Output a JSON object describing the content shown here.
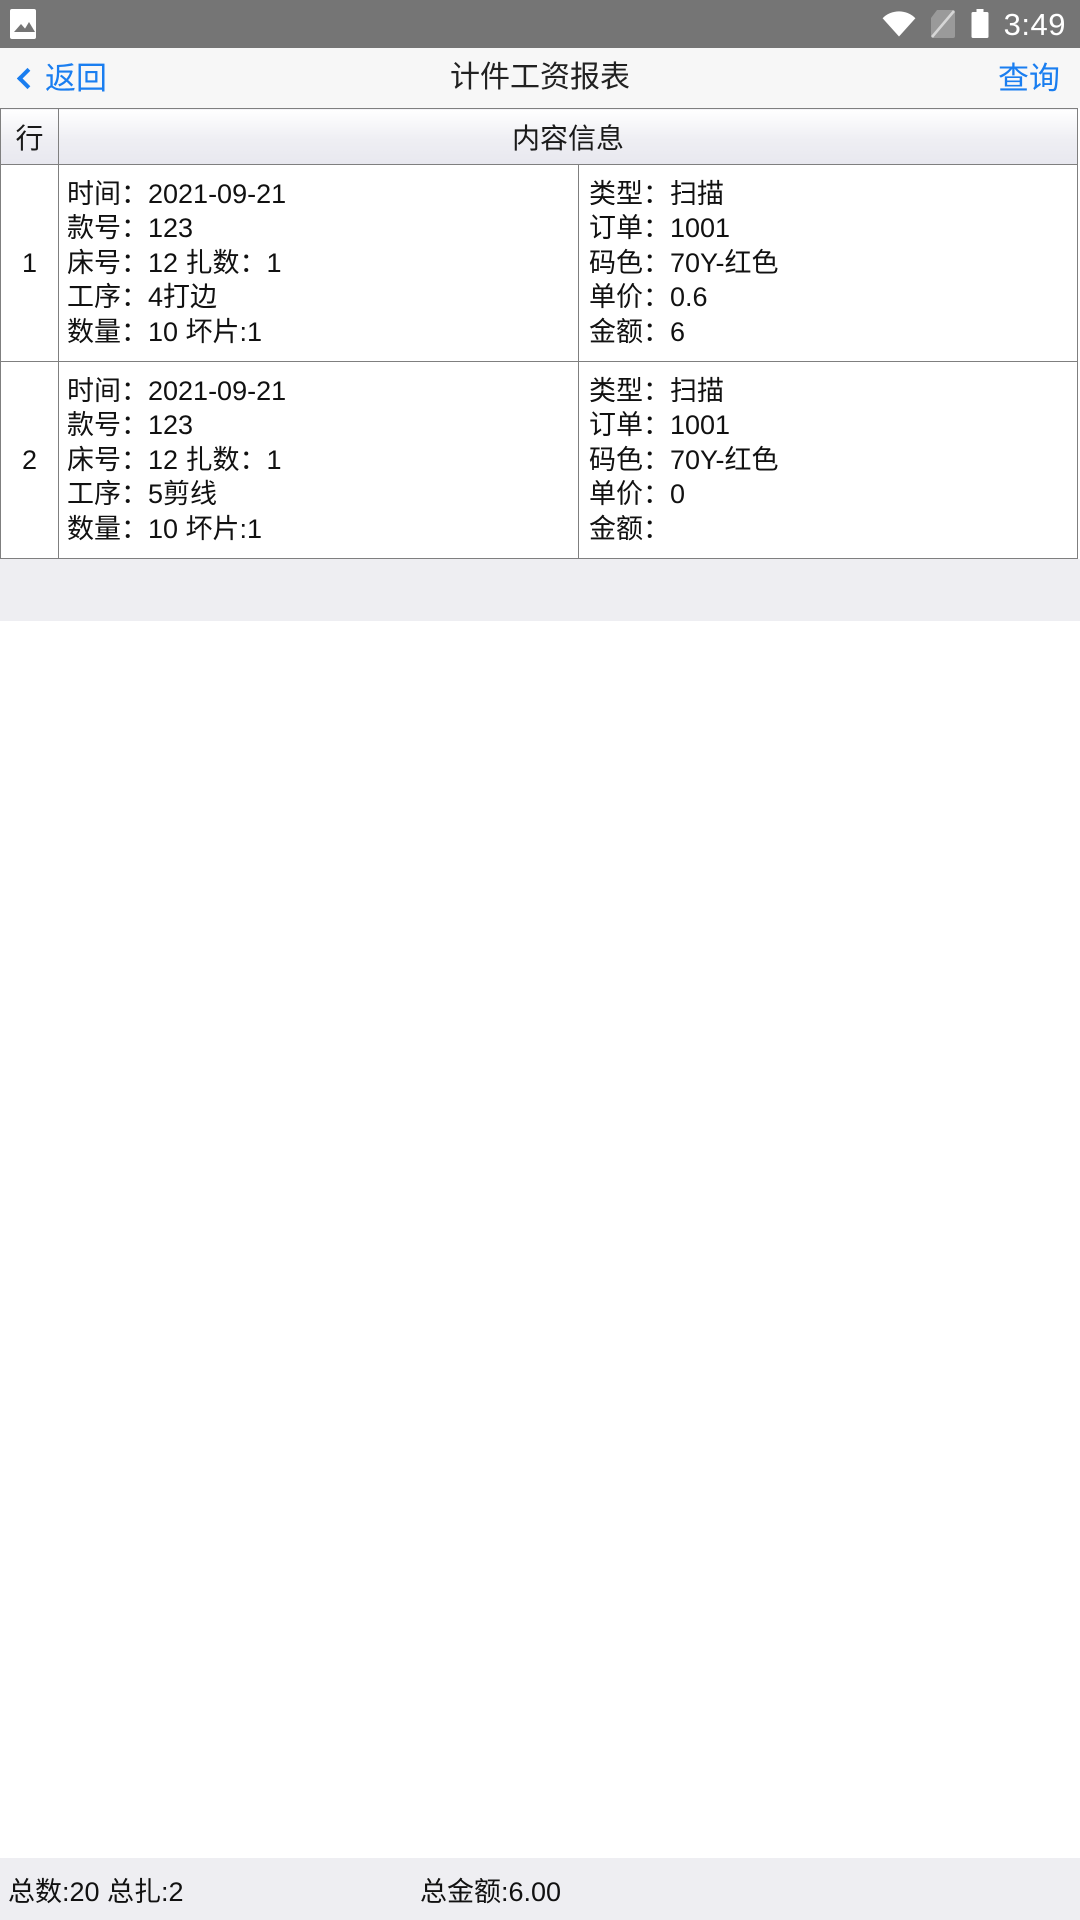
{
  "status_bar": {
    "time": "3:49",
    "icons": [
      "gallery-icon",
      "wifi-icon",
      "sim-card-off-icon",
      "battery-icon"
    ],
    "background_color": "#757575"
  },
  "header": {
    "back_label": "返回",
    "title": "计件工资报表",
    "action_label": "查询",
    "accent_color": "#1a7ef0",
    "background_color": "#f7f7f7"
  },
  "table": {
    "columns": [
      "行",
      "内容信息"
    ],
    "rows": [
      {
        "index": "1",
        "left": [
          "时间：2021-09-21",
          "款号：123",
          "床号：12 扎数：1",
          "工序：4打边",
          "数量：10 坏片:1"
        ],
        "right": [
          "类型：扫描",
          "订单：1001",
          "码色：70Y-红色",
          "单价：0.6",
          "金额：6"
        ]
      },
      {
        "index": "2",
        "left": [
          "时间：2021-09-21",
          "款号：123",
          "床号：12 扎数：1",
          "工序：5剪线",
          "数量：10 坏片:1"
        ],
        "right": [
          "类型：扫描",
          "订单：1001",
          "码色：70Y-红色",
          "单价：0",
          "金额："
        ]
      }
    ]
  },
  "summary": {
    "totals": "总数:20 总扎:2",
    "amount": "总金额:6.00",
    "background_color": "#eeeef2"
  }
}
